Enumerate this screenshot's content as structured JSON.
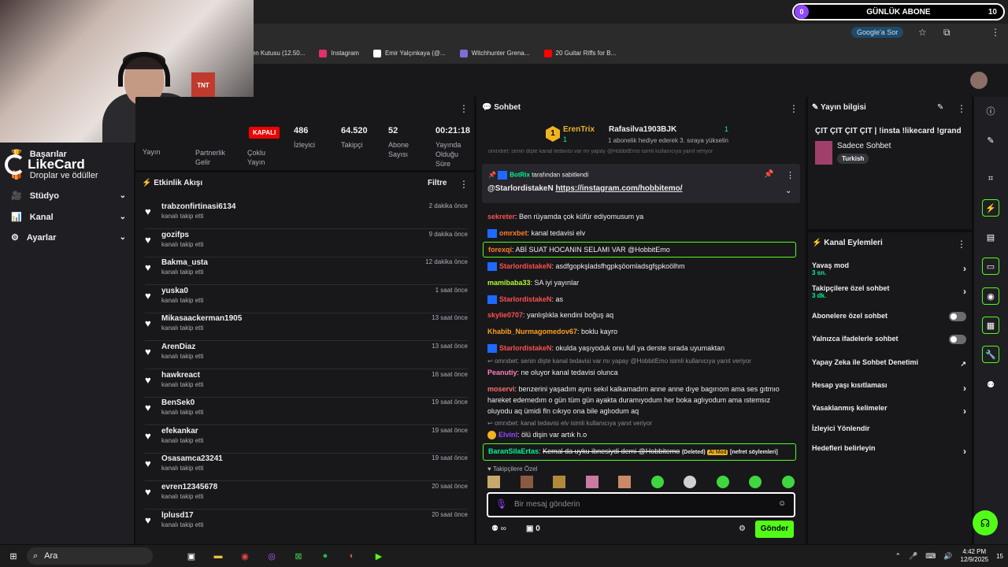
{
  "browser": {
    "google_btn": "Google'a Sor",
    "bookmarks": [
      {
        "label": "len Kutusu (12.50...",
        "color": "#6b6b6b"
      },
      {
        "label": "Instagram",
        "color": "#e1306c"
      },
      {
        "label": "Emir Yalçınkaya (@...",
        "color": "#ffffff"
      },
      {
        "label": "Witchhunter Grena...",
        "color": "#7a6fd8"
      },
      {
        "label": "20 Guitar Riffs for B...",
        "color": "#ff0000"
      }
    ]
  },
  "overlay": {
    "label": "GÜNLÜK ABONE",
    "start": "0",
    "goal": "10",
    "tnt": "TNT",
    "likecard": "LikeCard"
  },
  "nav": {
    "basarilar": "Başarılar",
    "droplar": "Droplar ve ödüller",
    "studyo": "Stüdyo",
    "kanal": "Kanal",
    "ayarlar": "Ayarlar"
  },
  "stats": {
    "status": "KAPALI",
    "items": [
      {
        "value": "486",
        "label": "İzleyici"
      },
      {
        "value": "64.520",
        "label": "Takipçi"
      },
      {
        "value": "52",
        "label": "Abone Sayısı"
      },
      {
        "value": "00:21:18",
        "label": "Yayında Olduğu Süre"
      }
    ],
    "bottom_labels": [
      "Yayın",
      "Partnerlik Gelir",
      "Çoklu Yayın"
    ]
  },
  "activity": {
    "title": "Etkinlik Akışı",
    "filter": "Filtre",
    "items": [
      {
        "name": "trabzonfirtinasi6134",
        "sub": "kanalı takip etti",
        "time": "2 dakika önce"
      },
      {
        "name": "gozifps",
        "sub": "kanalı takip etti",
        "time": "9 dakika önce"
      },
      {
        "name": "Bakma_usta",
        "sub": "kanalı takip etti",
        "time": "12 dakika önce"
      },
      {
        "name": "yuska0",
        "sub": "kanalı takip etti",
        "time": "1 saat önce"
      },
      {
        "name": "Mikasaackerman1905",
        "sub": "kanalı takip etti",
        "time": "13 saat önce"
      },
      {
        "name": "ArenDiaz",
        "sub": "kanalı takip etti",
        "time": "13 saat önce"
      },
      {
        "name": "hawkreact",
        "sub": "kanalı takip etti",
        "time": "16 saat önce"
      },
      {
        "name": "BenSek0",
        "sub": "kanalı takip etti",
        "time": "19 saat önce"
      },
      {
        "name": "efekankar",
        "sub": "kanalı takip etti",
        "time": "19 saat önce"
      },
      {
        "name": "Osasamca23241",
        "sub": "kanalı takip etti",
        "time": "19 saat önce"
      },
      {
        "name": "evren12345678",
        "sub": "kanalı takip etti",
        "time": "20 saat önce"
      },
      {
        "name": "lplusd17",
        "sub": "kanalı takip etti",
        "time": "20 saat önce"
      }
    ]
  },
  "chat": {
    "title": "Sohbet",
    "top_user": "ErenTrix",
    "top_count": "1",
    "gift_user": "Rafasilva1903BJK",
    "gift_count": "1",
    "gift_text": "1 abonelik hediye ederek 3. sıraya yükselin",
    "reply_ghost": "omrxbet: senin dişte kanal tedavisi var mı yapay @HobbitEmo isimli kullanıcıya yanıt veriyor",
    "pinned_by": "BotRix",
    "pinned_label": "tarafından sabitlendi",
    "pinned_user": "@StarlordistakeN",
    "pinned_link": "https://instagram.com/hobbitemo/",
    "messages": [
      {
        "user": "sekreter",
        "color": "#ff4f4f",
        "text": "Ben rüyamda çok küfür ediyomusum ya"
      },
      {
        "user": "omrxbet",
        "color": "#ff7f24",
        "text": "kanal tedavisi elv"
      },
      {
        "user": "forexqi",
        "color": "#ff7f24",
        "text": "ABİ SUAT HOCANIN SELAMI VAR @HobbitEmo"
      },
      {
        "user": "StarlordistakeN",
        "color": "#ff4f4f",
        "text": "asdfgopkşladsfhgpkşöomladsgfşpkoölhm"
      },
      {
        "user": "mamibaba33",
        "color": "#adff2f",
        "text": "SA iyi yayınlar"
      },
      {
        "user": "StarlordistakeN",
        "color": "#ff4f4f",
        "text": "as"
      },
      {
        "user": "skylie0707",
        "color": "#ff4f4f",
        "text": "yanlışlıkla kendini boğuş aq"
      },
      {
        "user": "Khabib_Nurmagomedov67",
        "color": "#ff9f1a",
        "text": "boklu kayro"
      },
      {
        "user": "StarlordistakeN",
        "color": "#ff4f4f",
        "text": "okulda yaşıyoduk onu full ya derste sırada uyumaktan"
      },
      {
        "user": "Peanutiy",
        "color": "#ff7fbf",
        "text": "ne oluyor kanal tedavisi olunca"
      },
      {
        "user": "moservi",
        "color": "#ff6f6f",
        "text": "benzerini yaşadım aynı sekıl kalkamadım anne anne dıye bagırıom ama ses gıtmıo hareket edemedım o gün tüm gün ayakta duramıyodum her boka aglıyodum ama ıstemsız oluyodu aq ümidi fln cıkıyo ona bile aglıodum aq"
      },
      {
        "user": "Elvinl",
        "color": "#9147ff",
        "text": "ölü dişin var artık h.o"
      },
      {
        "user": "BaranSilaErtas",
        "color": "#00f593",
        "text": "Kemal da uyku ibnesiydi demi @Hobbitemo"
      }
    ],
    "reply1": "omrxbet: senin dişte kanal tedavisi var mı yapay @HobbitEmo isimli kullanıcıya yanıt veriyor",
    "reply2": "omrxbet: kanal tedavisi elv isimli kullanıcıya yanıt veriyor",
    "deleted": "(Deleted)",
    "ai_mod": "AI Mod",
    "hate": "[nefret söylemleri]",
    "emote_label": "Takipçilere Özel",
    "placeholder": "Bir mesaj gönderin",
    "points": "0",
    "send": "Gönder"
  },
  "info": {
    "title": "Yayın bilgisi",
    "stream_title": "ÇIT ÇIT ÇIT ÇIT | !insta !likecard !grand",
    "category": "Sadece Sohbet",
    "lang": "Turkish"
  },
  "actions": {
    "title": "Kanal Eylemleri",
    "slow": "Yavaş mod",
    "slow_sub": "3 sn.",
    "followers": "Takipçilere özel sohbet",
    "followers_sub": "3 dk.",
    "subs": "Abonelere özel sohbet",
    "emotes": "Yalnızca ifadelerle sohbet",
    "ai": "Yapay Zeka ile Sohbet Denetimi",
    "age": "Hesap yaşı kısıtlaması",
    "banned": "Yasaklanmış kelimeler",
    "redirect": "İzleyici Yönlendir",
    "goals": "Hedefleri belirleyin"
  },
  "taskbar": {
    "search": "Ara",
    "time": "4:42 PM",
    "date": "12/9/2025",
    "notif": "15"
  }
}
